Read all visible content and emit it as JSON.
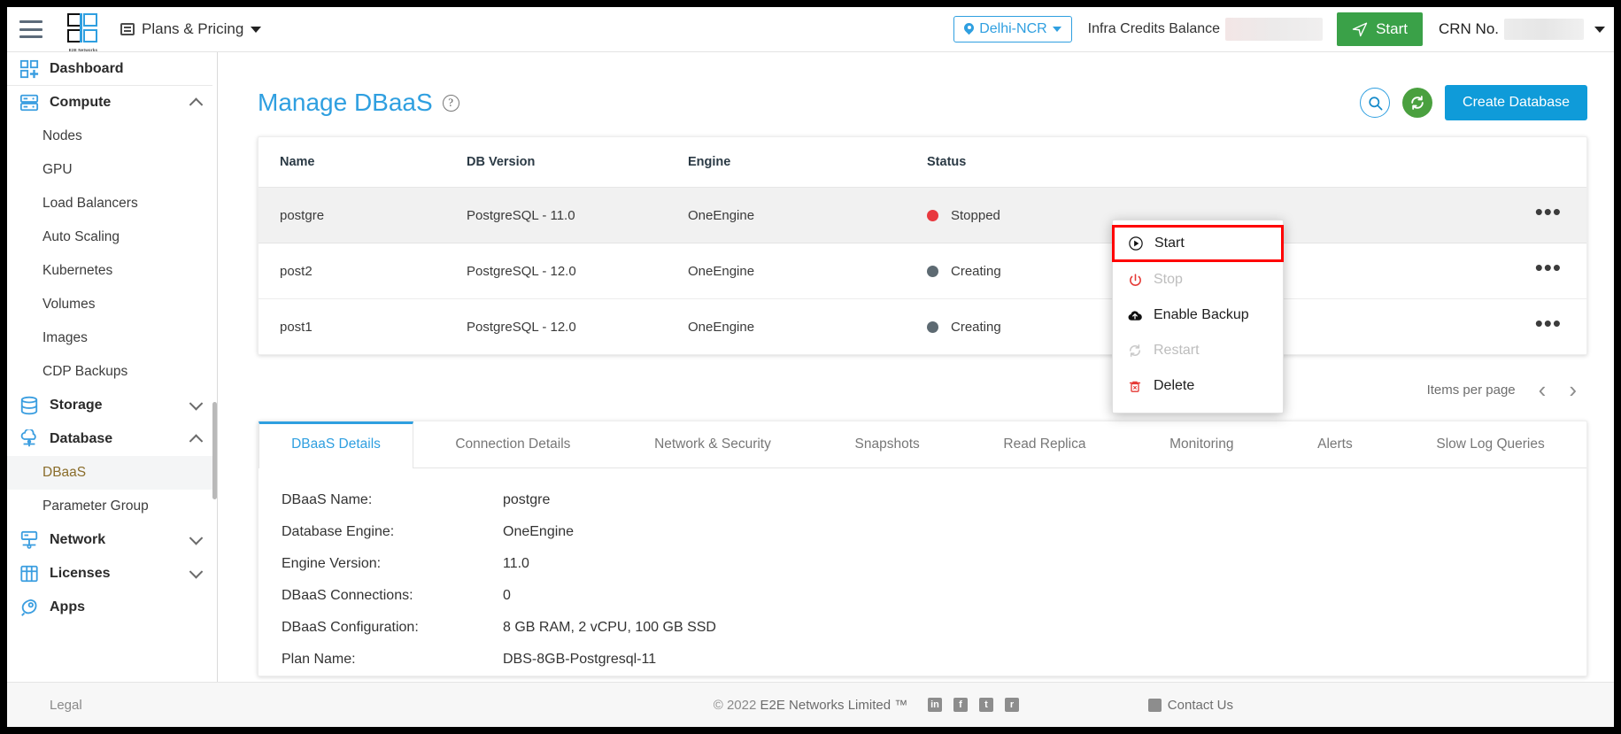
{
  "topbar": {
    "menu_icon": "hamburger-icon",
    "brand_caption": "E2E Networks",
    "plans_label": "Plans & Pricing",
    "region_label": "Delhi-NCR",
    "credits_label": "Infra Credits Balance",
    "start_label": "Start",
    "crn_label": "CRN No."
  },
  "sidebar": {
    "items": [
      {
        "label": "Dashboard",
        "type": "group",
        "icon": "dashboard-icon",
        "chevron": "none"
      },
      {
        "label": "Compute",
        "type": "group",
        "icon": "server-icon",
        "chevron": "up"
      },
      {
        "label": "Nodes",
        "type": "sub"
      },
      {
        "label": "GPU",
        "type": "sub"
      },
      {
        "label": "Load Balancers",
        "type": "sub"
      },
      {
        "label": "Auto Scaling",
        "type": "sub"
      },
      {
        "label": "Kubernetes",
        "type": "sub"
      },
      {
        "label": "Volumes",
        "type": "sub"
      },
      {
        "label": "Images",
        "type": "sub"
      },
      {
        "label": "CDP Backups",
        "type": "sub"
      },
      {
        "label": "Storage",
        "type": "group",
        "icon": "database-icon",
        "chevron": "down"
      },
      {
        "label": "Database",
        "type": "group",
        "icon": "cloud-db-icon",
        "chevron": "up"
      },
      {
        "label": "DBaaS",
        "type": "sub",
        "active": true
      },
      {
        "label": "Parameter Group",
        "type": "sub"
      },
      {
        "label": "Network",
        "type": "group",
        "icon": "network-icon",
        "chevron": "down"
      },
      {
        "label": "Licenses",
        "type": "group",
        "icon": "license-icon",
        "chevron": "down"
      },
      {
        "label": "Apps",
        "type": "group",
        "icon": "rocket-icon",
        "chevron": "none"
      }
    ]
  },
  "page": {
    "title": "Manage DBaaS",
    "help_icon": "question-mark-icon",
    "search_icon": "search-icon",
    "refresh_icon": "refresh-icon",
    "create_label": "Create Database"
  },
  "table": {
    "columns": [
      "Name",
      "DB Version",
      "Engine",
      "Status"
    ],
    "rows": [
      {
        "name": "postgre",
        "version": "PostgreSQL - 11.0",
        "engine": "OneEngine",
        "status": "Stopped",
        "status_color": "#e8393f",
        "highlight": true,
        "kebab": "•••"
      },
      {
        "name": "post2",
        "version": "PostgreSQL - 12.0",
        "engine": "OneEngine",
        "status": "Creating",
        "status_color": "#5d6a72",
        "highlight": false,
        "kebab": "•••"
      },
      {
        "name": "post1",
        "version": "PostgreSQL - 12.0",
        "engine": "OneEngine",
        "status": "Creating",
        "status_color": "#5d6a72",
        "highlight": false,
        "kebab": "•••"
      }
    ]
  },
  "pagination": {
    "items_per_page_label": "Items per page",
    "prev": "‹",
    "next": "›"
  },
  "context_menu": {
    "items": [
      {
        "label": "Start",
        "icon": "play-circle-icon",
        "disabled": false,
        "selected": true
      },
      {
        "label": "Stop",
        "icon": "power-icon",
        "disabled": true,
        "selected": false
      },
      {
        "label": "Enable Backup",
        "icon": "cloud-upload-icon",
        "disabled": false,
        "selected": false
      },
      {
        "label": "Restart",
        "icon": "restart-icon",
        "disabled": true,
        "selected": false
      },
      {
        "label": "Delete",
        "icon": "trash-icon",
        "disabled": false,
        "selected": false
      }
    ]
  },
  "tabs": [
    {
      "label": "DBaaS Details",
      "active": true
    },
    {
      "label": "Connection Details",
      "active": false
    },
    {
      "label": "Network & Security",
      "active": false
    },
    {
      "label": "Snapshots",
      "active": false
    },
    {
      "label": "Read Replica",
      "active": false
    },
    {
      "label": "Monitoring",
      "active": false
    },
    {
      "label": "Alerts",
      "active": false
    },
    {
      "label": "Slow Log Queries",
      "active": false
    }
  ],
  "details": [
    {
      "label": "DBaaS Name:",
      "value": "postgre"
    },
    {
      "label": "Database Engine:",
      "value": "OneEngine"
    },
    {
      "label": "Engine Version:",
      "value": "11.0"
    },
    {
      "label": "DBaaS Connections:",
      "value": "0"
    },
    {
      "label": "DBaaS Configuration:",
      "value": "8 GB RAM, 2 vCPU, 100 GB SSD"
    },
    {
      "label": "Plan Name:",
      "value": "DBS-8GB-Postgresql-11"
    }
  ],
  "footer": {
    "legal": "Legal",
    "copyright_prefix": "© 2022 ",
    "copyright_name": "E2E Networks Limited ™",
    "socials": [
      "in",
      "f",
      "t",
      "r"
    ],
    "contact": "Contact Us"
  }
}
